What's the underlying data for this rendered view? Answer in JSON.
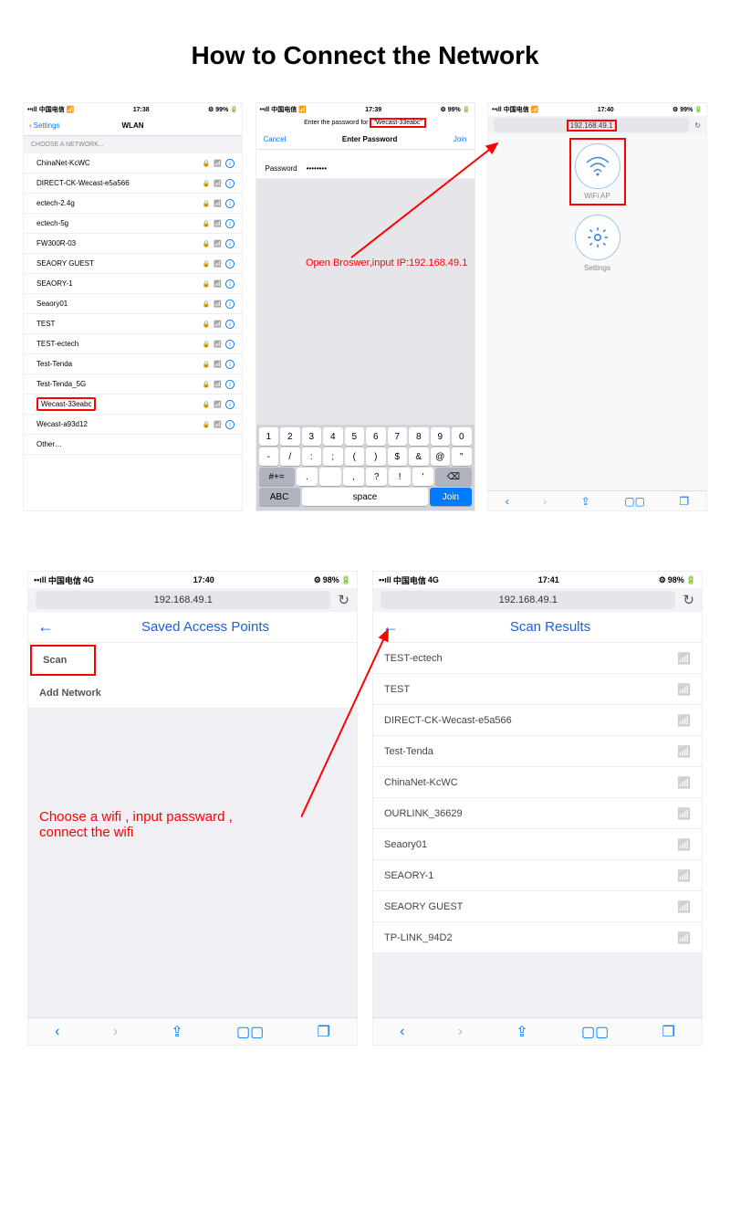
{
  "page": {
    "title": "How to Connect the Network"
  },
  "statusbar": {
    "carrier": "中国电信",
    "radio": "4G",
    "battery": "99%",
    "battery2": "98%",
    "t1": "17:38",
    "t2": "17:39",
    "t3": "17:40",
    "t4": "17:40",
    "t5": "17:41"
  },
  "screen1": {
    "back": "Settings",
    "title": "WLAN",
    "section": "CHOOSE A NETWORK...",
    "networks": [
      "ChinaNet-KcWC",
      "DIRECT-CK-Wecast-e5a566",
      "ectech-2.4g",
      "ectech-5g",
      "FW300R-03",
      "SEAORY GUEST",
      "SEAORY-1",
      "Seaory01",
      "TEST",
      "TEST-ectech",
      "Test-Tenda",
      "Test-Tenda_5G",
      "Wecast-33eabc",
      "Wecast-a93d12",
      "Other…"
    ],
    "highlight_index": 12
  },
  "screen2": {
    "prompt_prefix": "Enter the password for ",
    "prompt_ssid": "\"Wecast-33eabc\"",
    "cancel": "Cancel",
    "title": "Enter Password",
    "join": "Join",
    "pwd_label": "Password",
    "pwd_mask": "••••••••",
    "kb_r1": [
      "1",
      "2",
      "3",
      "4",
      "5",
      "6",
      "7",
      "8",
      "9",
      "0"
    ],
    "kb_r2": [
      "-",
      "/",
      ":",
      ";",
      "(",
      ")",
      "$",
      "&",
      "@",
      "\""
    ],
    "kb_r3_shift": "#+=",
    "kb_r3": [
      ".",
      "",
      ",",
      "?",
      "!",
      "'"
    ],
    "kb_r3_del": "⌫",
    "kb_abc": "ABC",
    "kb_space": "space",
    "kb_join": "Join"
  },
  "annot1": "Open Broswer,input IP:192.168.49.1",
  "screen3": {
    "url": "192.168.49.1",
    "wifi_label": "WiFi AP",
    "settings_label": "Settings"
  },
  "screen4": {
    "url": "192.168.49.1",
    "title": "Saved Access Points",
    "scan": "Scan",
    "add": "Add Network",
    "annot_l1": "Choose a wifi , input passward ,",
    "annot_l2": "connect the wifi"
  },
  "screen5": {
    "url": "192.168.49.1",
    "title": "Scan Results",
    "results": [
      "TEST-ectech",
      "TEST",
      "DIRECT-CK-Wecast-e5a566",
      "Test-Tenda",
      "ChinaNet-KcWC",
      "OURLINK_36629",
      "Seaory01",
      "SEAORY-1",
      "SEAORY GUEST",
      "TP-LINK_94D2"
    ]
  }
}
